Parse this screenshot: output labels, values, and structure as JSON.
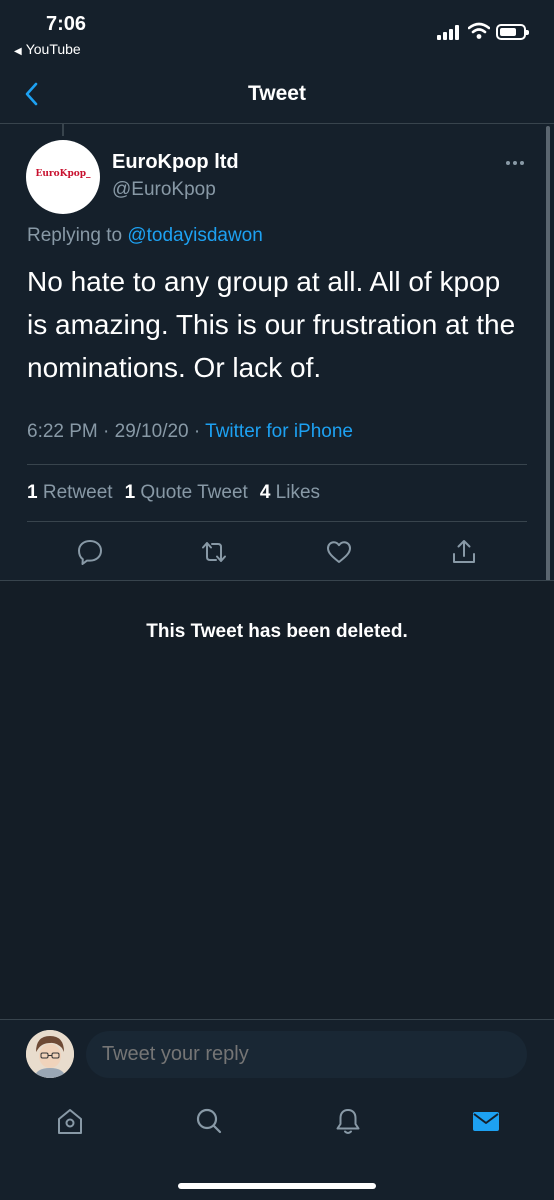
{
  "status_bar": {
    "time": "7:06",
    "back_app": "YouTube",
    "back_arrow": "◀"
  },
  "nav": {
    "title": "Tweet",
    "back_icon": "chevron-left-icon"
  },
  "tweet": {
    "author_name": "EuroKpop ltd",
    "author_handle": "@EuroKpop",
    "avatar_text": "EuroKpop_",
    "replying_prefix": "Replying to",
    "replying_to": "@todayisdawon",
    "text": "No hate to any group at all. All of kpop is amazing. This is our frustration at the nominations. Or lack of.",
    "timestamp": "6:22 PM · 29/10/20",
    "separator": "·",
    "client": "Twitter for iPhone"
  },
  "stats": {
    "retweets_count": "1",
    "retweets_label": "Retweet",
    "quotes_count": "1",
    "quotes_label": "Quote Tweet",
    "likes_count": "4",
    "likes_label": "Likes"
  },
  "deleted_message": "This Tweet has been deleted.",
  "reply": {
    "placeholder": "Tweet your reply"
  },
  "colors": {
    "background": "#15202b",
    "accent": "#1da1f2",
    "secondary_text": "#8899a6",
    "divider": "#38444d"
  }
}
